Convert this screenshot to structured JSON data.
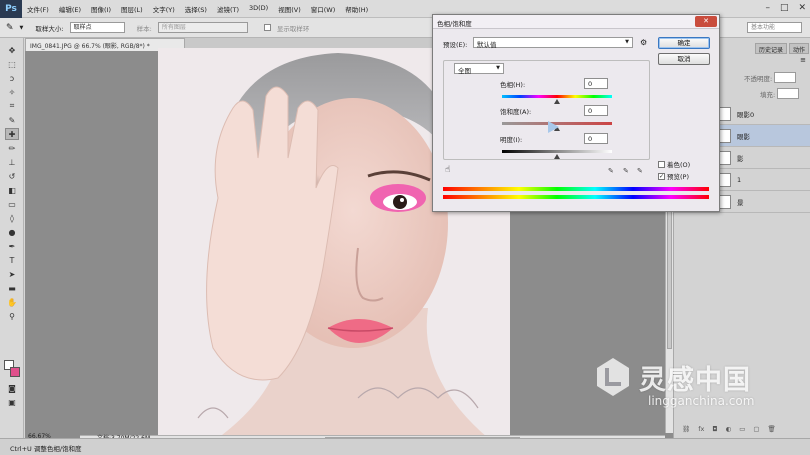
{
  "app": {
    "logo": "Ps"
  },
  "menu": [
    "文件(F)",
    "编辑(E)",
    "图像(I)",
    "图层(L)",
    "文字(Y)",
    "选择(S)",
    "滤镜(T)",
    "3D(D)",
    "视图(V)",
    "窗口(W)",
    "帮助(H)"
  ],
  "options": {
    "sample_size_label": "取样大小:",
    "sample_size_value": "取样点",
    "sample_label": "样本:",
    "sample_value": "所有图层",
    "show_ring_label": "显示取样环",
    "workspace_value": "基本功能"
  },
  "document": {
    "tab_title": "IMG_0841.JPG @ 66.7% (眼影, RGB/8*) *",
    "zoom": "66.67%",
    "doc_size": "文档:3.70M/22.6M"
  },
  "hint": "Ctrl+U 调整色相/饱和度",
  "dialog": {
    "title": "色相/饱和度",
    "close": "✕",
    "preset_label": "预设(E):",
    "preset_value": "默认值",
    "channel_value": "全图",
    "hue_label": "色相(H):",
    "hue_value": "0",
    "saturation_label": "饱和度(A):",
    "saturation_value": "0",
    "lightness_label": "明度(I):",
    "lightness_value": "0",
    "ok": "确定",
    "cancel": "取消",
    "colorize_label": "着色(O)",
    "colorize_checked": false,
    "preview_label": "预览(P)",
    "preview_checked": true,
    "slider_levels": {
      "hue": 0.5,
      "saturation": 0.5,
      "lightness": 0.5
    }
  },
  "panels": {
    "tabs": [
      "历史记录",
      "动作"
    ],
    "opacity_label": "不透明度:",
    "fill_label": "填充:",
    "layers": [
      {
        "name": "眼影0",
        "selected": false
      },
      {
        "name": "眼影",
        "selected": true
      },
      {
        "name": "影",
        "selected": false
      },
      {
        "name": "1",
        "selected": false
      },
      {
        "name": "景",
        "selected": false
      }
    ]
  },
  "watermark": {
    "title": "灵感中国",
    "subtitle": "lingganchina.com"
  },
  "colors": {
    "accent": "#3a78c2",
    "close": "#c94c3d",
    "bg_swatch": "#e0508c"
  }
}
